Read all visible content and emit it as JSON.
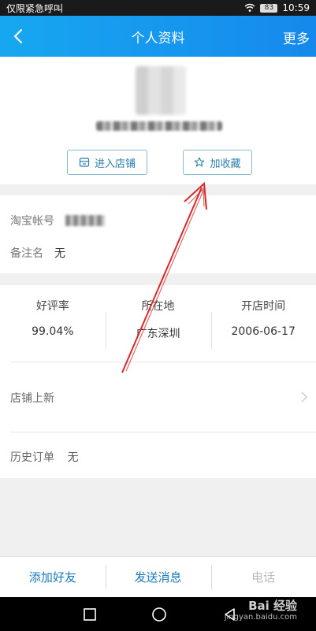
{
  "status_bar": {
    "carrier": "仅限紧急呼叫",
    "battery": "83",
    "time": "10:59"
  },
  "header": {
    "title": "个人资料",
    "more_label": "更多"
  },
  "profile": {
    "enter_shop_label": "进入店铺",
    "favorite_label": "加收藏"
  },
  "account": {
    "taobao_label": "淘宝帐号",
    "remark_label": "备注名",
    "remark_value": "无"
  },
  "stats": [
    {
      "title": "好评率",
      "value": "99.04%"
    },
    {
      "title": "所在地",
      "value": "广东深圳"
    },
    {
      "title": "开店时间",
      "value": "2006-06-17"
    }
  ],
  "shop": {
    "new_items_label": "店铺上新",
    "history_label": "历史订单",
    "history_value": "无"
  },
  "bottom_actions": {
    "add_friend": "添加好友",
    "send_message": "发送消息",
    "phone": "电话"
  },
  "watermark": {
    "text": "Bai 经验",
    "sub": "jingyan.baidu.com"
  },
  "colors": {
    "header_start": "#17a7f0",
    "header_end": "#1689ec",
    "link_blue": "#1979b8",
    "annotation_red": "#d42a2a"
  }
}
